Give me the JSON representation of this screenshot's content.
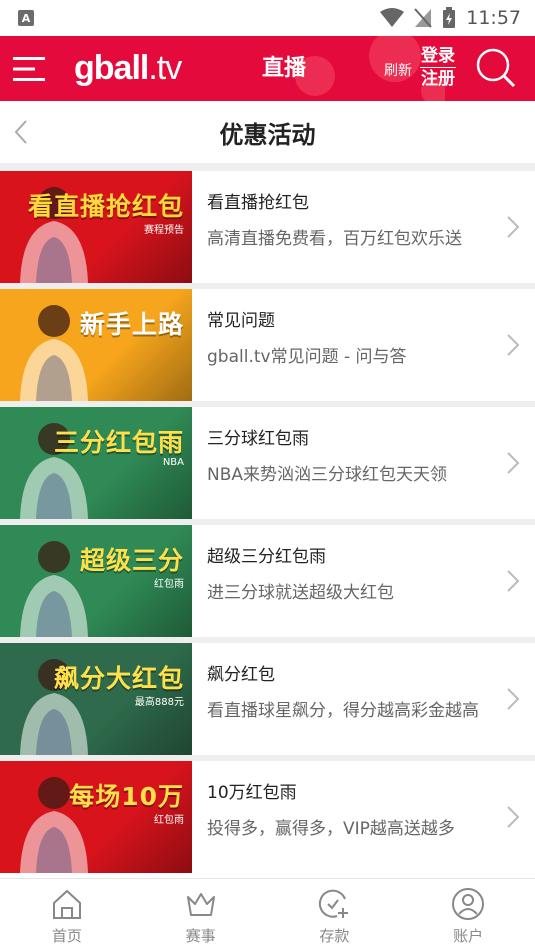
{
  "status_bar": {
    "time": "11:57",
    "indicator": "A"
  },
  "header": {
    "logo_main": "gball",
    "logo_suffix": ".tv",
    "title": "直播",
    "refresh": "刷新",
    "login": "登录",
    "register": "注册",
    "brand_color": "#e40a3b"
  },
  "nav": {
    "title": "优惠活动"
  },
  "promos": [
    {
      "banner": "看直播抢红包",
      "banner_sub": "赛程预告",
      "bg": "#d8131c",
      "banner_color": "#ffd93b",
      "title": "看直播抢红包",
      "desc": "高清直播免费看，百万红包欢乐送"
    },
    {
      "banner": "新手上路",
      "banner_sub": "",
      "bg": "#f6a51c",
      "banner_color": "#ffffff",
      "title": "常见问题",
      "desc": "gball.tv常见问题 - 问与答"
    },
    {
      "banner": "三分红包雨",
      "banner_sub": "NBA",
      "bg": "#2f8a55",
      "banner_color": "#ffe04a",
      "title": "三分球红包雨",
      "desc": "NBA来势汹汹三分球红包天天领"
    },
    {
      "banner": "超级三分",
      "banner_sub": "红包雨",
      "bg": "#2f8a55",
      "banner_color": "#ffe04a",
      "title": "超级三分红包雨",
      "desc": "进三分球就送超级大红包"
    },
    {
      "banner": "飙分大红包",
      "banner_sub": "最高888元",
      "bg": "#2e6a4b",
      "banner_color": "#ffe04a",
      "title": "飙分红包",
      "desc": "看直播球星飙分，得分越高彩金越高"
    },
    {
      "banner": "每场10万",
      "banner_sub": "红包雨",
      "bg": "#d8131c",
      "banner_color": "#ffe04a",
      "title": "10万红包雨",
      "desc": "投得多，赢得多，VIP越高送越多"
    }
  ],
  "tabs": [
    {
      "label": "首页",
      "icon": "home-icon"
    },
    {
      "label": "赛事",
      "icon": "crown-icon"
    },
    {
      "label": "存款",
      "icon": "deposit-icon"
    },
    {
      "label": "账户",
      "icon": "account-icon"
    }
  ]
}
